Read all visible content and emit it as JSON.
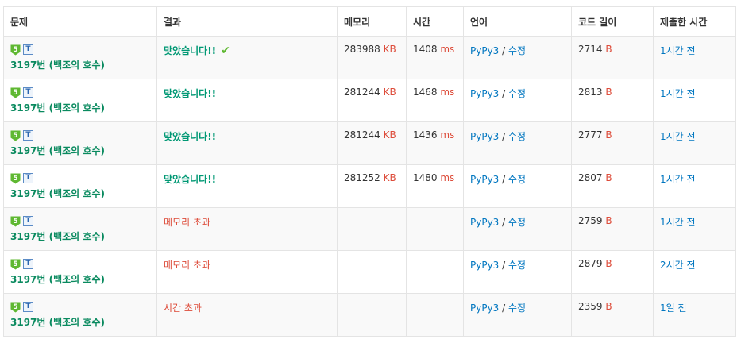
{
  "columns": [
    "문제",
    "결과",
    "메모리",
    "시간",
    "언어",
    "코드 길이",
    "제출한 시간"
  ],
  "units": {
    "memory": "KB",
    "time": "ms",
    "length": "B"
  },
  "colors": {
    "accepted": "#009874",
    "error": "#dd4b39",
    "link": "#0076c0",
    "tier": "#5fb832"
  },
  "rows": [
    {
      "tier": "5",
      "tag": "T",
      "problem": "3197번 (백조의 호수)",
      "result": "맞았습니다!!",
      "result_type": "accepted",
      "check_icon": true,
      "memory": "283988",
      "time": "1408",
      "lang": "PyPy3",
      "lang_sep": " / ",
      "edit": "수정",
      "length": "2714",
      "submitted": "1시간 전"
    },
    {
      "tier": "5",
      "tag": "T",
      "problem": "3197번 (백조의 호수)",
      "result": "맞았습니다!!",
      "result_type": "accepted",
      "check_icon": false,
      "memory": "281244",
      "time": "1468",
      "lang": "PyPy3",
      "lang_sep": " / ",
      "edit": "수정",
      "length": "2813",
      "submitted": "1시간 전"
    },
    {
      "tier": "5",
      "tag": "T",
      "problem": "3197번 (백조의 호수)",
      "result": "맞았습니다!!",
      "result_type": "accepted",
      "check_icon": false,
      "memory": "281244",
      "time": "1436",
      "lang": "PyPy3",
      "lang_sep": " / ",
      "edit": "수정",
      "length": "2777",
      "submitted": "1시간 전"
    },
    {
      "tier": "5",
      "tag": "T",
      "problem": "3197번 (백조의 호수)",
      "result": "맞았습니다!!",
      "result_type": "accepted",
      "check_icon": false,
      "memory": "281252",
      "time": "1480",
      "lang": "PyPy3",
      "lang_sep": " / ",
      "edit": "수정",
      "length": "2807",
      "submitted": "1시간 전"
    },
    {
      "tier": "5",
      "tag": "T",
      "problem": "3197번 (백조의 호수)",
      "result": "메모리 초과",
      "result_type": "error",
      "check_icon": false,
      "memory": "",
      "time": "",
      "lang": "PyPy3",
      "lang_sep": " / ",
      "edit": "수정",
      "length": "2759",
      "submitted": "1시간 전"
    },
    {
      "tier": "5",
      "tag": "T",
      "problem": "3197번 (백조의 호수)",
      "result": "메모리 초과",
      "result_type": "error",
      "check_icon": false,
      "memory": "",
      "time": "",
      "lang": "PyPy3",
      "lang_sep": " / ",
      "edit": "수정",
      "length": "2879",
      "submitted": "2시간 전"
    },
    {
      "tier": "5",
      "tag": "T",
      "problem": "3197번 (백조의 호수)",
      "result": "시간 초과",
      "result_type": "error",
      "check_icon": false,
      "memory": "",
      "time": "",
      "lang": "PyPy3",
      "lang_sep": " / ",
      "edit": "수정",
      "length": "2359",
      "submitted": "1일 전"
    }
  ]
}
